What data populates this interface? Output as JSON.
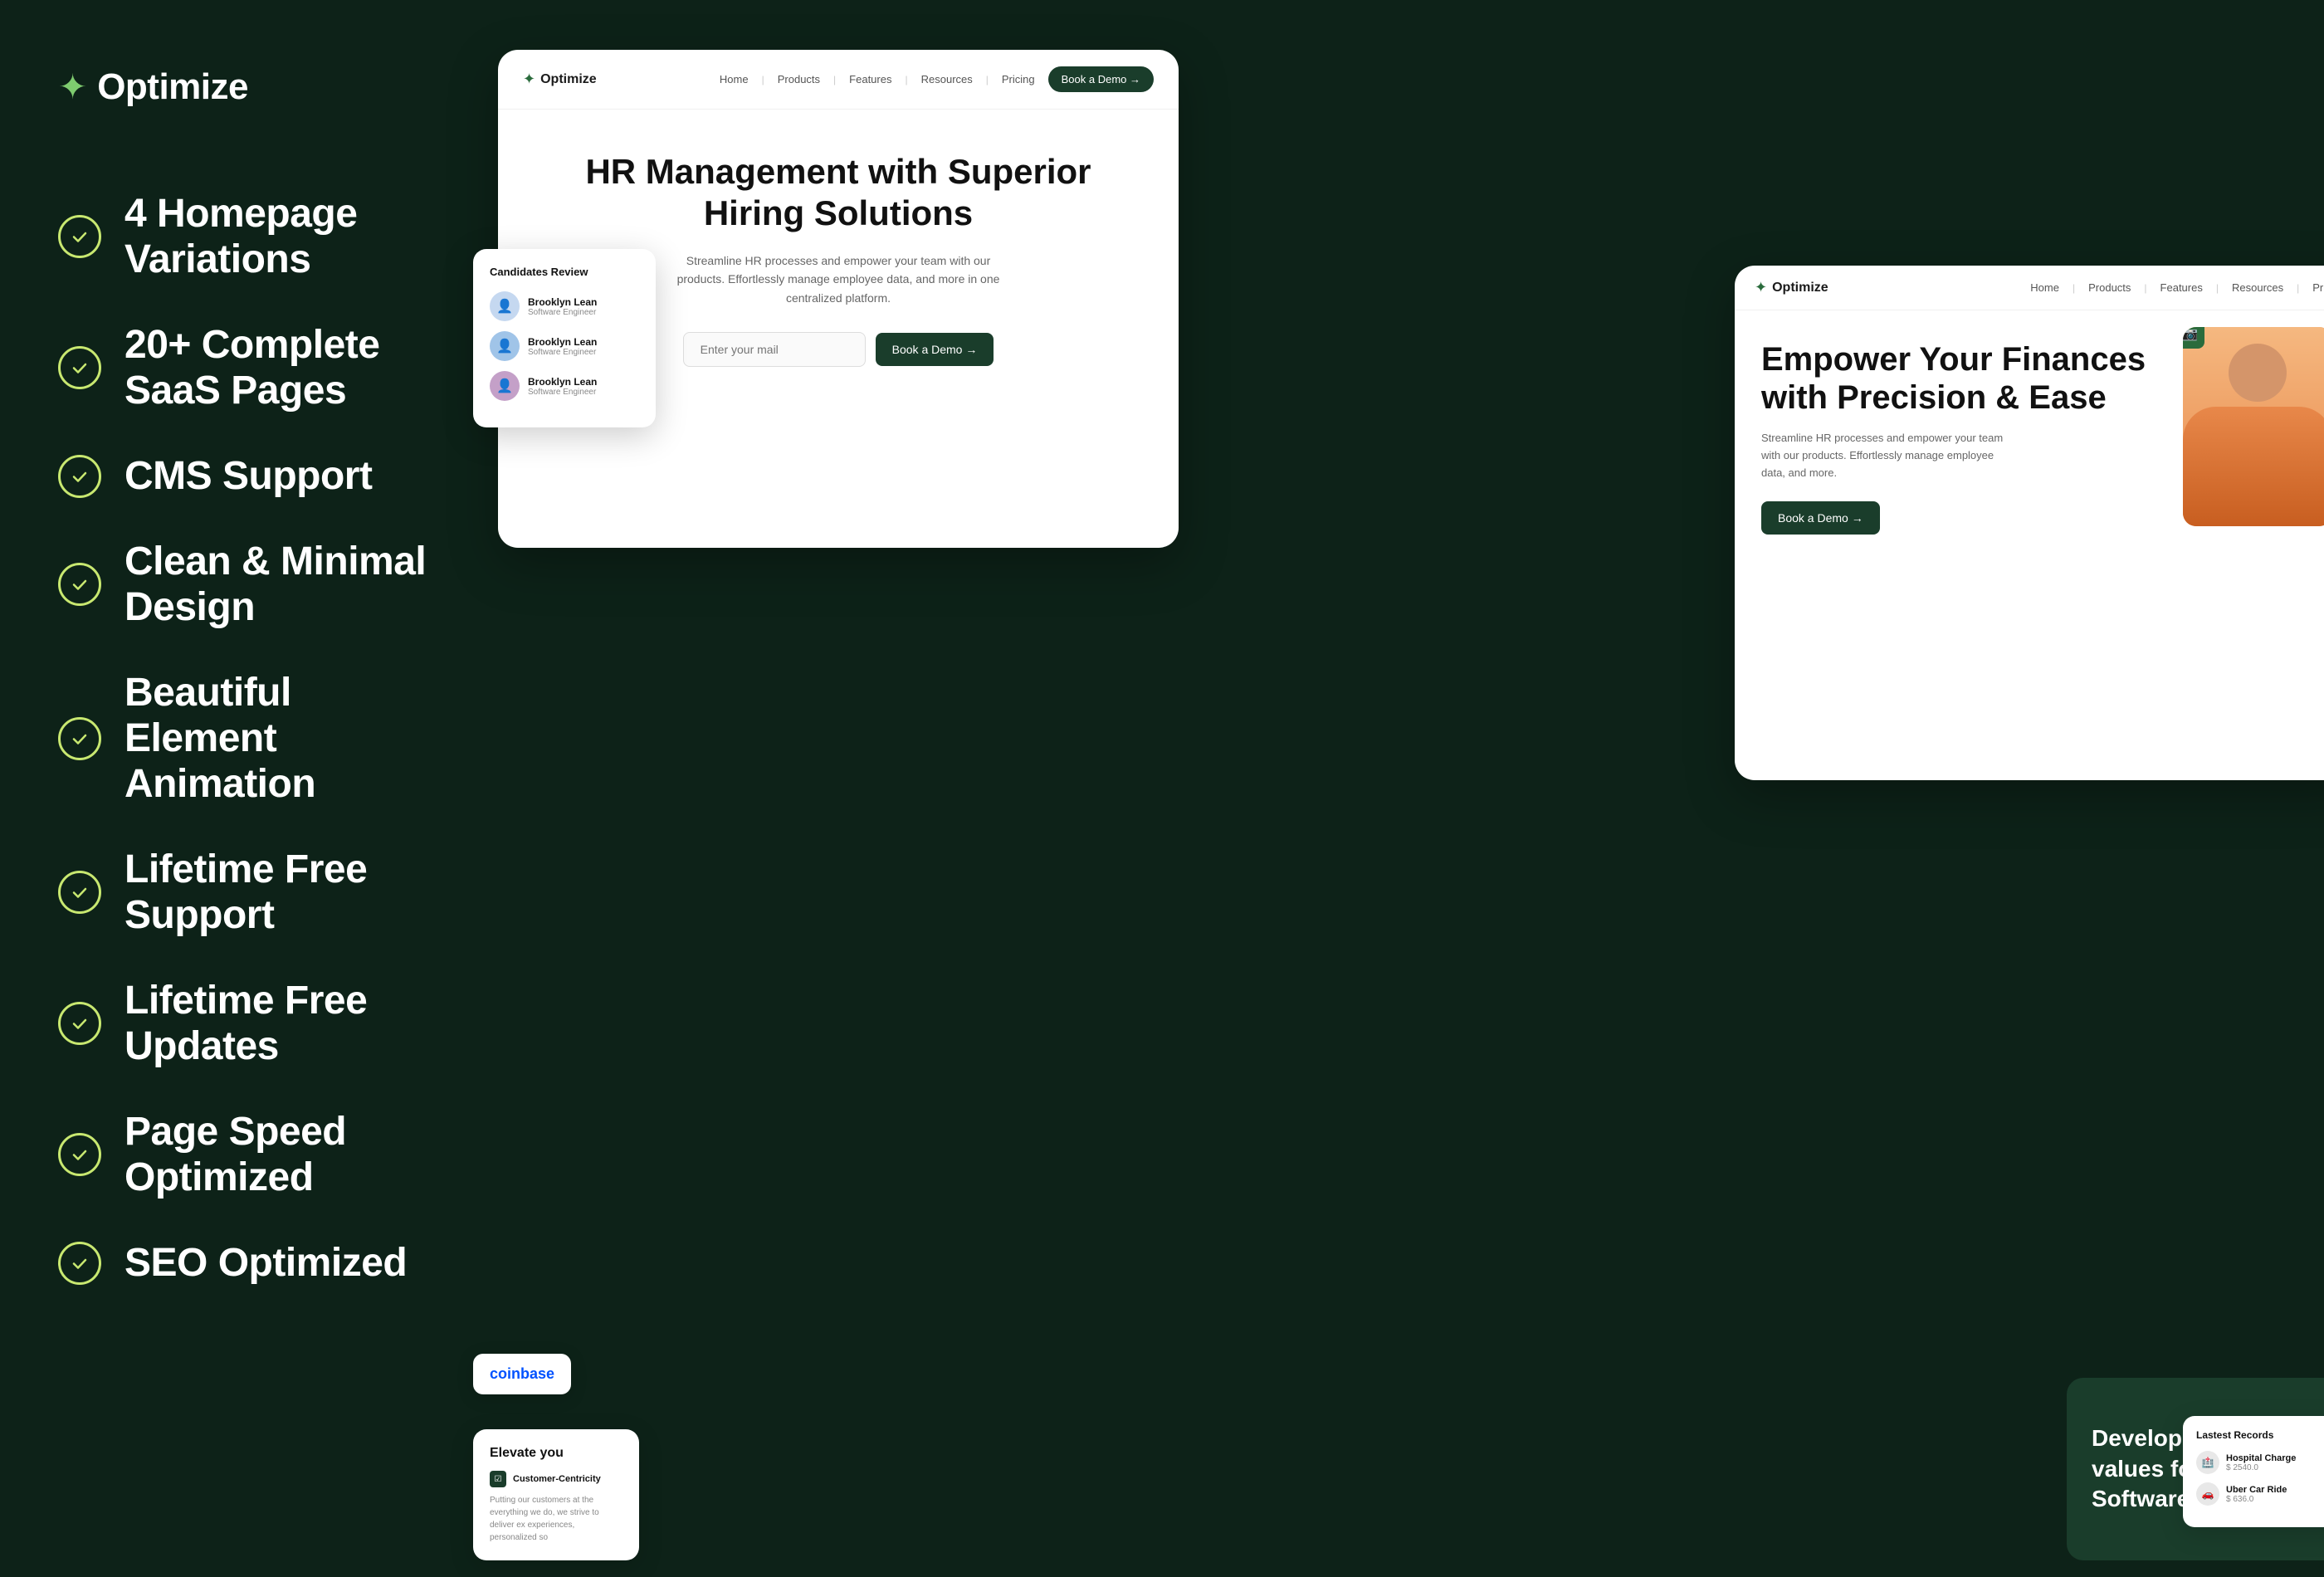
{
  "brand": {
    "name": "Optimize",
    "icon": "✦"
  },
  "features": [
    {
      "id": "homepage-variations",
      "label": "4 Homepage Variations"
    },
    {
      "id": "saas-pages",
      "label": "20+ Complete SaaS Pages"
    },
    {
      "id": "cms-support",
      "label": "CMS Support"
    },
    {
      "id": "clean-design",
      "label": "Clean & Minimal Design"
    },
    {
      "id": "animation",
      "label": "Beautiful Element Animation"
    },
    {
      "id": "free-support",
      "label": "Lifetime Free Support"
    },
    {
      "id": "free-updates",
      "label": "Lifetime Free Updates"
    },
    {
      "id": "page-speed",
      "label": "Page Speed Optimized"
    },
    {
      "id": "seo",
      "label": "SEO Optimized"
    }
  ],
  "card_hr": {
    "nav": {
      "logo_icon": "✦",
      "logo_text": "Optimize",
      "links": [
        "Home",
        "Products",
        "Features",
        "Resources",
        "Pricing"
      ],
      "cta_label": "Book a Demo →"
    },
    "hero": {
      "title": "HR Management with Superior Hiring Solutions",
      "subtitle": "Streamline HR processes and empower your team with our products. Effortlessly manage employee data, and more in one centralized platform.",
      "input_placeholder": "Enter your mail",
      "cta_label": "Book a Demo →"
    }
  },
  "card_finance": {
    "nav": {
      "logo_icon": "✦",
      "logo_text": "Optimize",
      "links": [
        "Home",
        "Products",
        "Features",
        "Resources",
        "Pricing"
      ]
    },
    "hero": {
      "title": "Empower Your Finances with Precision & Ease",
      "subtitle": "Streamline HR processes and empower your team with our products. Effortlessly manage employee data, and more.",
      "cta_label": "Book a Demo →"
    }
  },
  "candidates": {
    "title": "Candidates Review",
    "items": [
      {
        "name": "Brooklyn Lean",
        "role": "Software Engineer"
      },
      {
        "name": "Brooklyn Lean",
        "role": "Software Engineer"
      },
      {
        "name": "Brooklyn Lean",
        "role": "Software Engineer"
      }
    ]
  },
  "records": {
    "title": "Lastest Records",
    "items": [
      {
        "name": "Hospital Charge",
        "amount": "$ 2540.0"
      },
      {
        "name": "Uber Car Ride",
        "amount": "$ 636.0"
      }
    ]
  },
  "logos": {
    "items": [
      "coinbase"
    ]
  },
  "dark_card": {
    "title": "Developing company values for a financial Software"
  },
  "elevate": {
    "title": "Elevate you",
    "badge_label": "Customer-Centricity",
    "description": "Putting our customers at the everything we do, we strive to deliver ex experiences, personalized so"
  }
}
